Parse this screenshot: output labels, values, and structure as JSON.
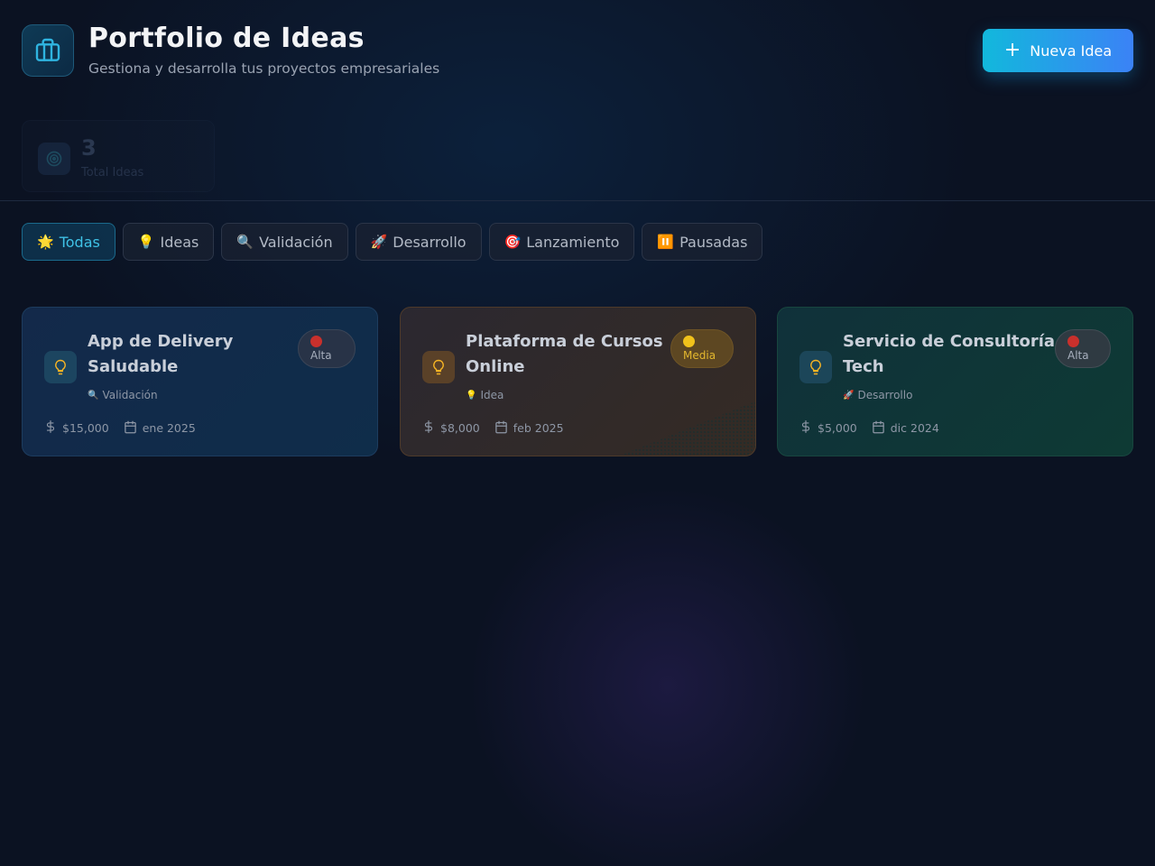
{
  "header": {
    "title": "Portfolio de Ideas",
    "subtitle": "Gestiona y desarrolla tus proyectos empresariales",
    "new_button": "Nueva Idea"
  },
  "stats": {
    "value": "3",
    "label": "Total Ideas"
  },
  "filters": [
    {
      "emoji": "🌟",
      "label": "Todas",
      "active": true
    },
    {
      "emoji": "💡",
      "label": "Ideas"
    },
    {
      "emoji": "🔍",
      "label": "Validación"
    },
    {
      "emoji": "🚀",
      "label": "Desarrollo"
    },
    {
      "emoji": "🎯",
      "label": "Lanzamiento"
    },
    {
      "emoji": "⏸️",
      "label": "Pausadas"
    }
  ],
  "cards": [
    {
      "title": "App de Delivery Saludable",
      "stage_emoji": "🔍",
      "stage": "Validación",
      "priority": "Alta",
      "priority_color": "#c9302c",
      "budget": "$15,000",
      "date": "ene 2025"
    },
    {
      "title": "Plataforma de Cursos Online",
      "stage_emoji": "💡",
      "stage": "Idea",
      "priority": "Media",
      "priority_color": "#f1c21b",
      "budget": "$8,000",
      "date": "feb 2025"
    },
    {
      "title": "Servicio de Consultoría Tech",
      "stage_emoji": "🚀",
      "stage": "Desarrollo",
      "priority": "Alta",
      "priority_color": "#c9302c",
      "budget": "$5,000",
      "date": "dic 2024"
    }
  ]
}
